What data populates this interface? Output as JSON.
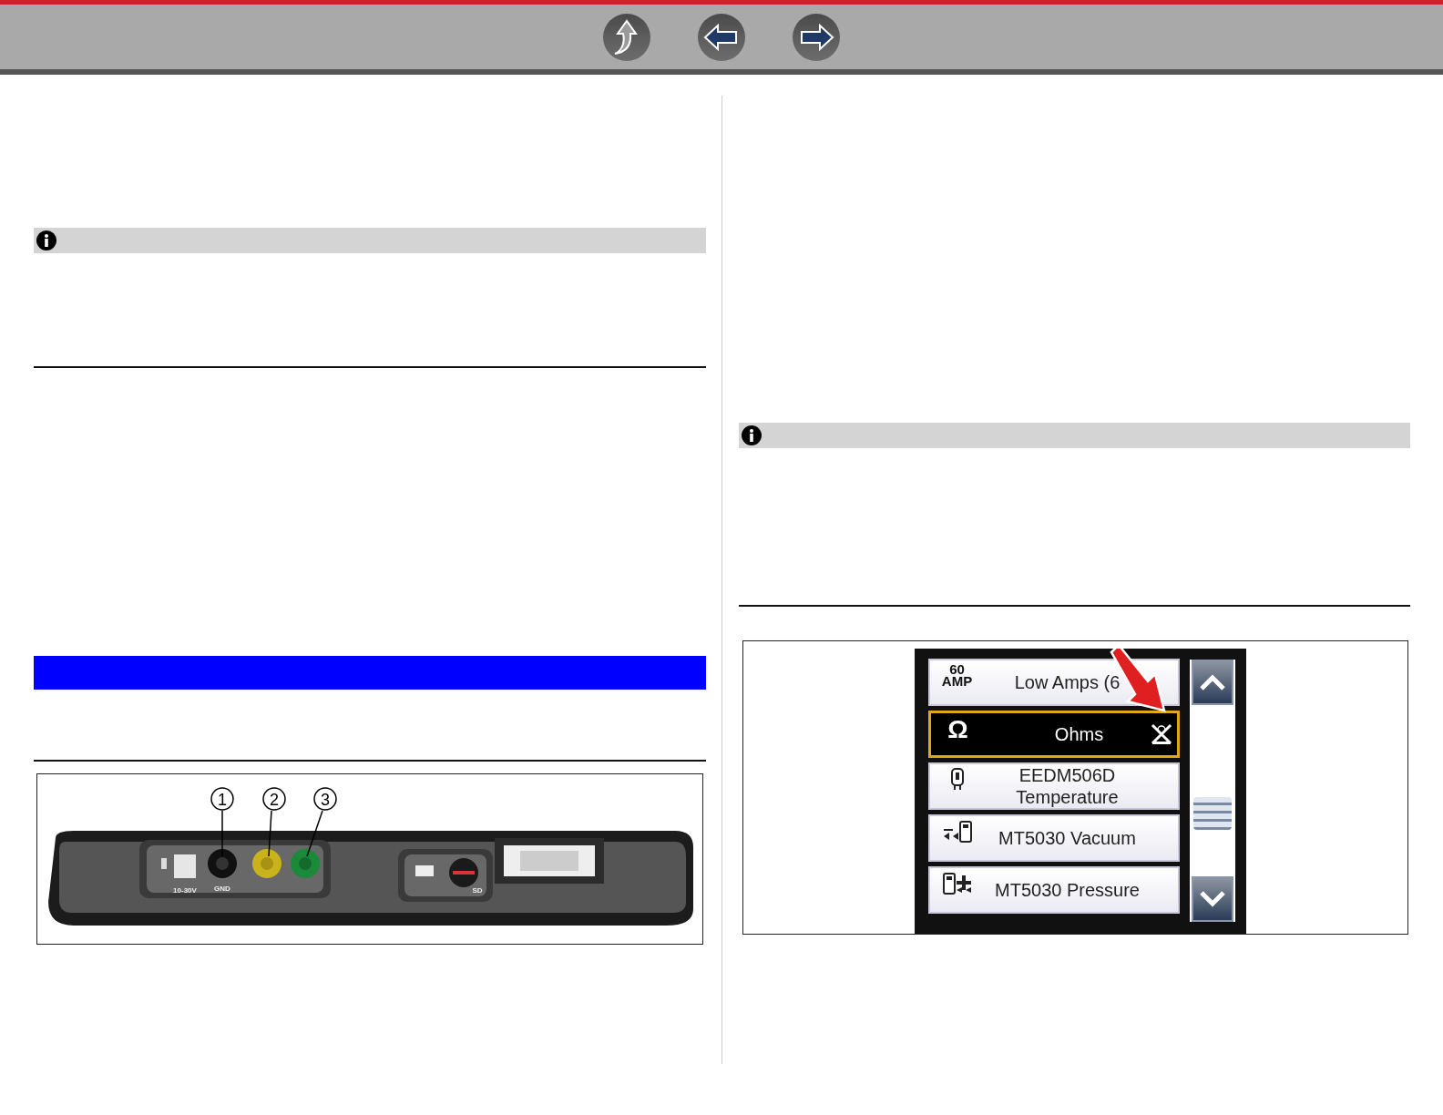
{
  "toolbar": {
    "buttons": [
      {
        "kind": "up"
      },
      {
        "kind": "back"
      },
      {
        "kind": "forward"
      }
    ]
  },
  "left_column": [
    {
      "kind": "note"
    },
    {
      "kind": "rule"
    },
    {
      "kind": "banner"
    },
    {
      "kind": "rule"
    },
    {
      "kind": "device_figure",
      "callouts": [
        "1",
        "2",
        "3"
      ],
      "port_labels": [
        {
          "kind": "power",
          "text": "10-30V"
        },
        {
          "kind": "ground",
          "text": "GND"
        },
        {
          "kind": "sd",
          "text": "SD"
        }
      ]
    }
  ],
  "right_column": [
    {
      "kind": "note"
    },
    {
      "kind": "rule"
    },
    {
      "kind": "screen_figure",
      "items": [
        {
          "label": "Low Amps (6",
          "kind": "amp",
          "icon_text": [
            "60",
            "AMP"
          ],
          "selected": false,
          "disabled_mark": false
        },
        {
          "label": "Ohms",
          "kind": "ohm",
          "icon_text": [
            "Ω"
          ],
          "selected": true,
          "disabled_mark": true
        },
        {
          "label": "EEDM506D Temperature",
          "kind": "probe",
          "selected": false,
          "disabled_mark": false
        },
        {
          "label": "MT5030 Vacuum",
          "kind": "vacuum",
          "selected": false,
          "disabled_mark": false
        },
        {
          "label": "MT5030 Pressure",
          "kind": "pressure",
          "selected": false,
          "disabled_mark": false
        }
      ]
    }
  ]
}
